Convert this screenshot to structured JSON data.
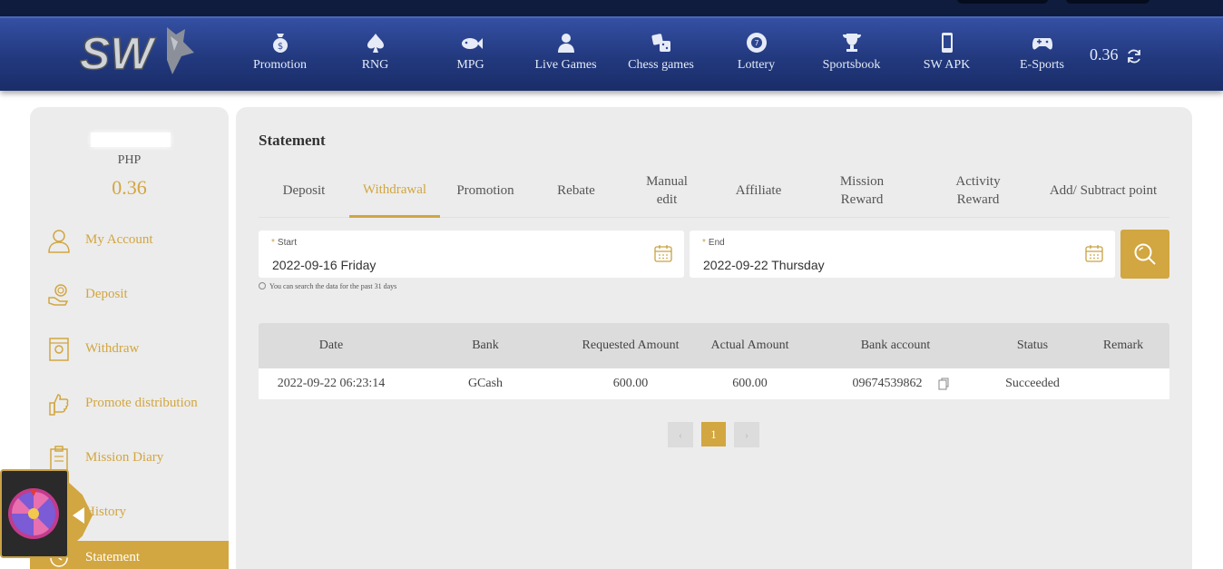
{
  "header": {
    "logo_text": "SW",
    "nav": [
      {
        "label": "Promotion",
        "icon": "money-bag-icon"
      },
      {
        "label": "RNG",
        "icon": "spade-icon"
      },
      {
        "label": "MPG",
        "icon": "fish-icon"
      },
      {
        "label": "Live Games",
        "icon": "dealer-icon"
      },
      {
        "label": "Chess games",
        "icon": "dice-icon"
      },
      {
        "label": "Lottery",
        "icon": "lottery-ball-icon"
      },
      {
        "label": "Sportsbook",
        "icon": "trophy-icon"
      },
      {
        "label": "SW APK",
        "icon": "phone-icon"
      },
      {
        "label": "E-Sports",
        "icon": "gamepad-icon"
      }
    ],
    "balance": "0.36"
  },
  "sidebar": {
    "currency": "PHP",
    "balance": "0.36",
    "items": [
      {
        "label": "My Account",
        "icon": "user-icon"
      },
      {
        "label": "Deposit",
        "icon": "deposit-hand-icon"
      },
      {
        "label": "Withdraw",
        "icon": "withdraw-icon"
      },
      {
        "label": "Promote distribution",
        "icon": "thumbs-up-icon"
      },
      {
        "label": "Mission Diary",
        "icon": "clipboard-icon"
      },
      {
        "label": "History",
        "icon": "history-icon"
      },
      {
        "label": "Statement",
        "icon": "statement-icon"
      }
    ]
  },
  "main": {
    "title": "Statement",
    "tabs": [
      "Deposit",
      "Withdrawal",
      "Promotion",
      "Rebate",
      "Manual edit",
      "Affiliate",
      "Mission Reward",
      "Activity Reward",
      "Add/ Subtract point"
    ],
    "active_tab": "Withdrawal",
    "start": {
      "label": "Start",
      "value": "2022-09-16 Friday"
    },
    "end": {
      "label": "End",
      "value": "2022-09-22 Thursday"
    },
    "hint": "You can search the data for the past 31 days",
    "table": {
      "headers": [
        "Date",
        "Bank",
        "Requested Amount",
        "Actual Amount",
        "Bank account",
        "Status",
        "Remark"
      ],
      "rows": [
        {
          "date": "2022-09-22 06:23:14",
          "bank": "GCash",
          "requested": "600.00",
          "actual": "600.00",
          "account": "09674539862",
          "status": "Succeeded",
          "remark": ""
        }
      ]
    },
    "pagination": {
      "prev": "‹",
      "current": "1",
      "next": "›"
    }
  },
  "colors": {
    "accent": "#d2a640",
    "header": "#22397e",
    "panel": "#ececec"
  }
}
